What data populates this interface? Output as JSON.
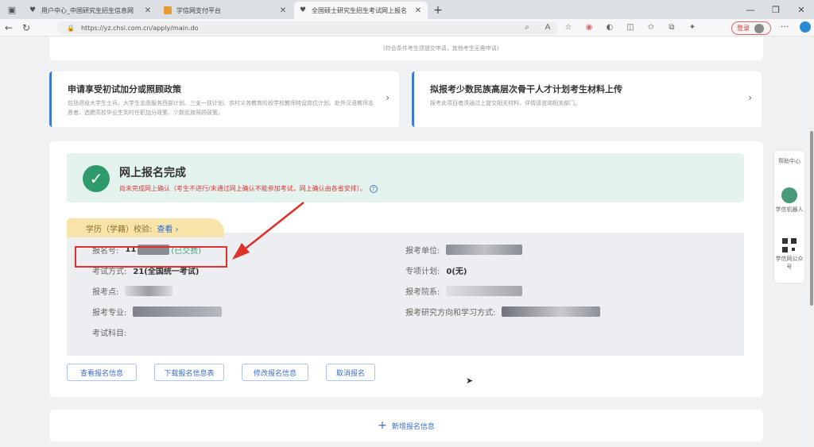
{
  "browser": {
    "tabs": [
      {
        "title": "用户中心_中国研究生招生信息网",
        "active": false,
        "fav_color": "#555555"
      },
      {
        "title": "学信网支付平台",
        "active": false,
        "fav_color": "#e69a2e"
      },
      {
        "title": "全国硕士研究生招生考试网上报名",
        "active": true,
        "fav_color": "#555555"
      }
    ],
    "new_tab": "+",
    "url": "https://yz.chsi.com.cn/apply/main.do",
    "login_label": "登录"
  },
  "page": {
    "top_note": "(符合条件考生须提交申请，其他考生无需申请)",
    "policy_cards": [
      {
        "title": "申请享受初试加分或照顾政策",
        "desc": "包括退役大学生士兵、大学生志愿服务西部计划、三支一扶计划、农村义务教育阶段学校教师特设岗位计划、赴外汉语教师志愿者、选聘高校毕业生到村任职加分政策、少数民族照顾政策。"
      },
      {
        "title": "拟报考少数民族高层次骨干人才计划考生材料上传",
        "desc": "报考此项目者须通过上提交相关材料，详情请咨询相关部门。"
      }
    ],
    "status": {
      "title": "网上报名完成",
      "warning": "尚未完成网上确认（考生不进行/未通过网上确认不能参加考试，网上确认由各省安排）。",
      "help_icon": "?"
    },
    "xueli": {
      "label": "学历（学籍）校验:",
      "link": "查看"
    },
    "fields": {
      "reg_no_label": "报名号:",
      "reg_no_prefix": "11",
      "reg_no_status": "(已交费)",
      "exam_method_label": "考试方式:",
      "exam_method_value": "21(全国统一考试)",
      "exam_site_label": "报考点:",
      "major_label": "报考专业:",
      "subjects_label": "考试科目:",
      "unit_label": "报考单位:",
      "special_plan_label": "专项计划:",
      "special_plan_value": "0(无)",
      "dept_label": "报考院系:",
      "direction_label": "报考研究方向和学习方式:"
    },
    "buttons": {
      "view": "查看报名信息",
      "download": "下载报名信息表",
      "modify": "修改报名信息",
      "cancel": "取消报名"
    },
    "new_reg": {
      "plus": "+",
      "label": "新增报名信息"
    },
    "side": {
      "help": "帮助中心",
      "robot": "学信机器人",
      "wechat": "学信网公众号"
    }
  },
  "colors": {
    "accent": "#3d7bd9",
    "success": "#2f9a6c",
    "warning": "#d93a3a",
    "annotation": "#e0302a"
  }
}
